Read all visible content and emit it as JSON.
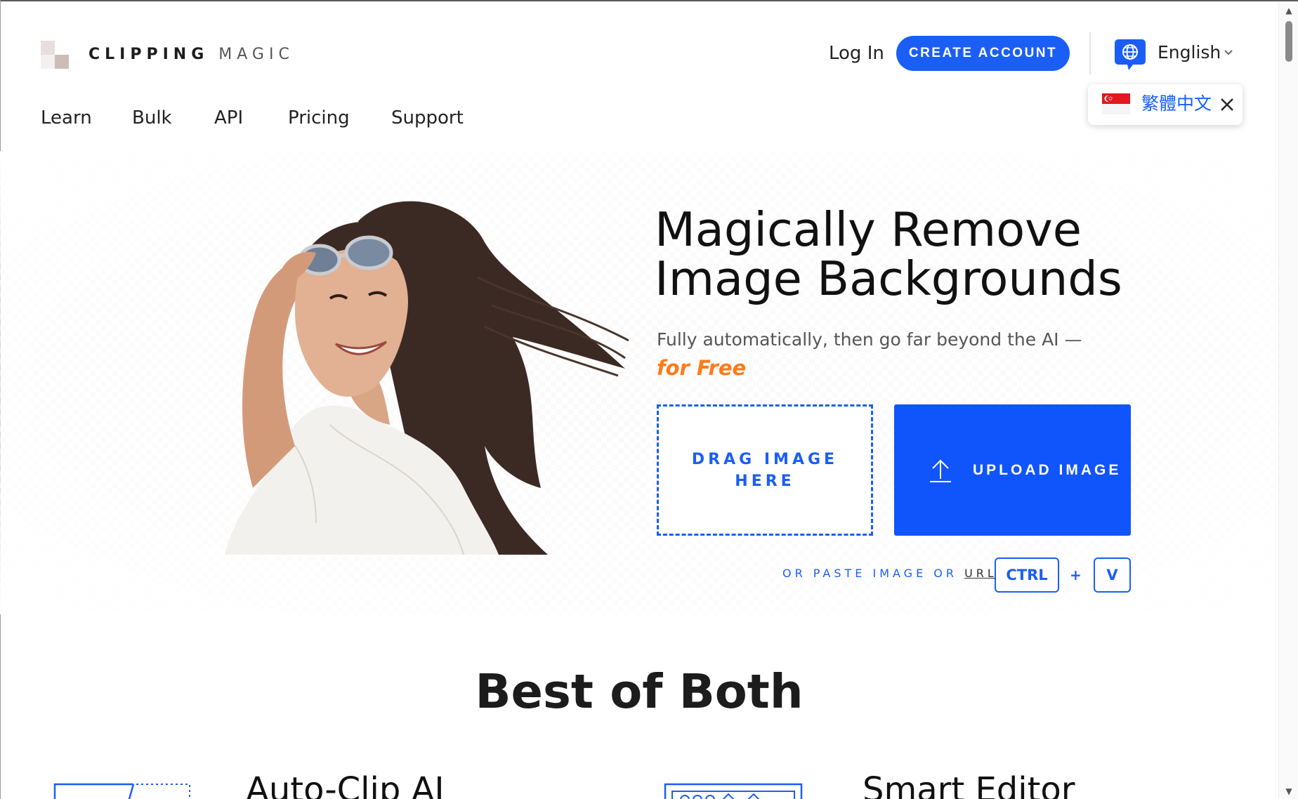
{
  "header": {
    "logo_bold": "CLIPPING",
    "logo_light": "MAGIC",
    "login_label": "Log In",
    "create_account_label": "CREATE ACCOUNT",
    "language_label": "English",
    "language_icon": "globe-chat-icon",
    "language_suggestion": {
      "flag": "singapore-flag-icon",
      "label": "繁體中文",
      "close_icon": "close-icon"
    }
  },
  "nav": {
    "items": [
      {
        "label": "Learn"
      },
      {
        "label": "Bulk"
      },
      {
        "label": "API"
      },
      {
        "label": "Pricing"
      },
      {
        "label": "Support"
      }
    ]
  },
  "hero": {
    "title_line1": "Magically Remove",
    "title_line2": "Image Backgrounds",
    "subtitle": "Fully automatically, then go far beyond the AI —",
    "subtitle_highlight": "for Free",
    "drop_zone_label": "DRAG IMAGE HERE",
    "upload_label": "UPLOAD IMAGE",
    "upload_icon": "upload-arrow-icon",
    "paste_text": "OR PASTE IMAGE OR",
    "paste_url": "URL",
    "key_ctrl": "CTRL",
    "key_plus": "+",
    "key_v": "V"
  },
  "section": {
    "title": "Best of Both",
    "features": [
      {
        "title": "Auto-Clip AI",
        "icon": "auto-clip-icon"
      },
      {
        "title": "Smart Editor",
        "icon": "smart-editor-icon"
      }
    ]
  },
  "colors": {
    "accent": "#1a5ef5",
    "upload_blue": "#0f55fb",
    "highlight_orange": "#ff7a1a"
  }
}
